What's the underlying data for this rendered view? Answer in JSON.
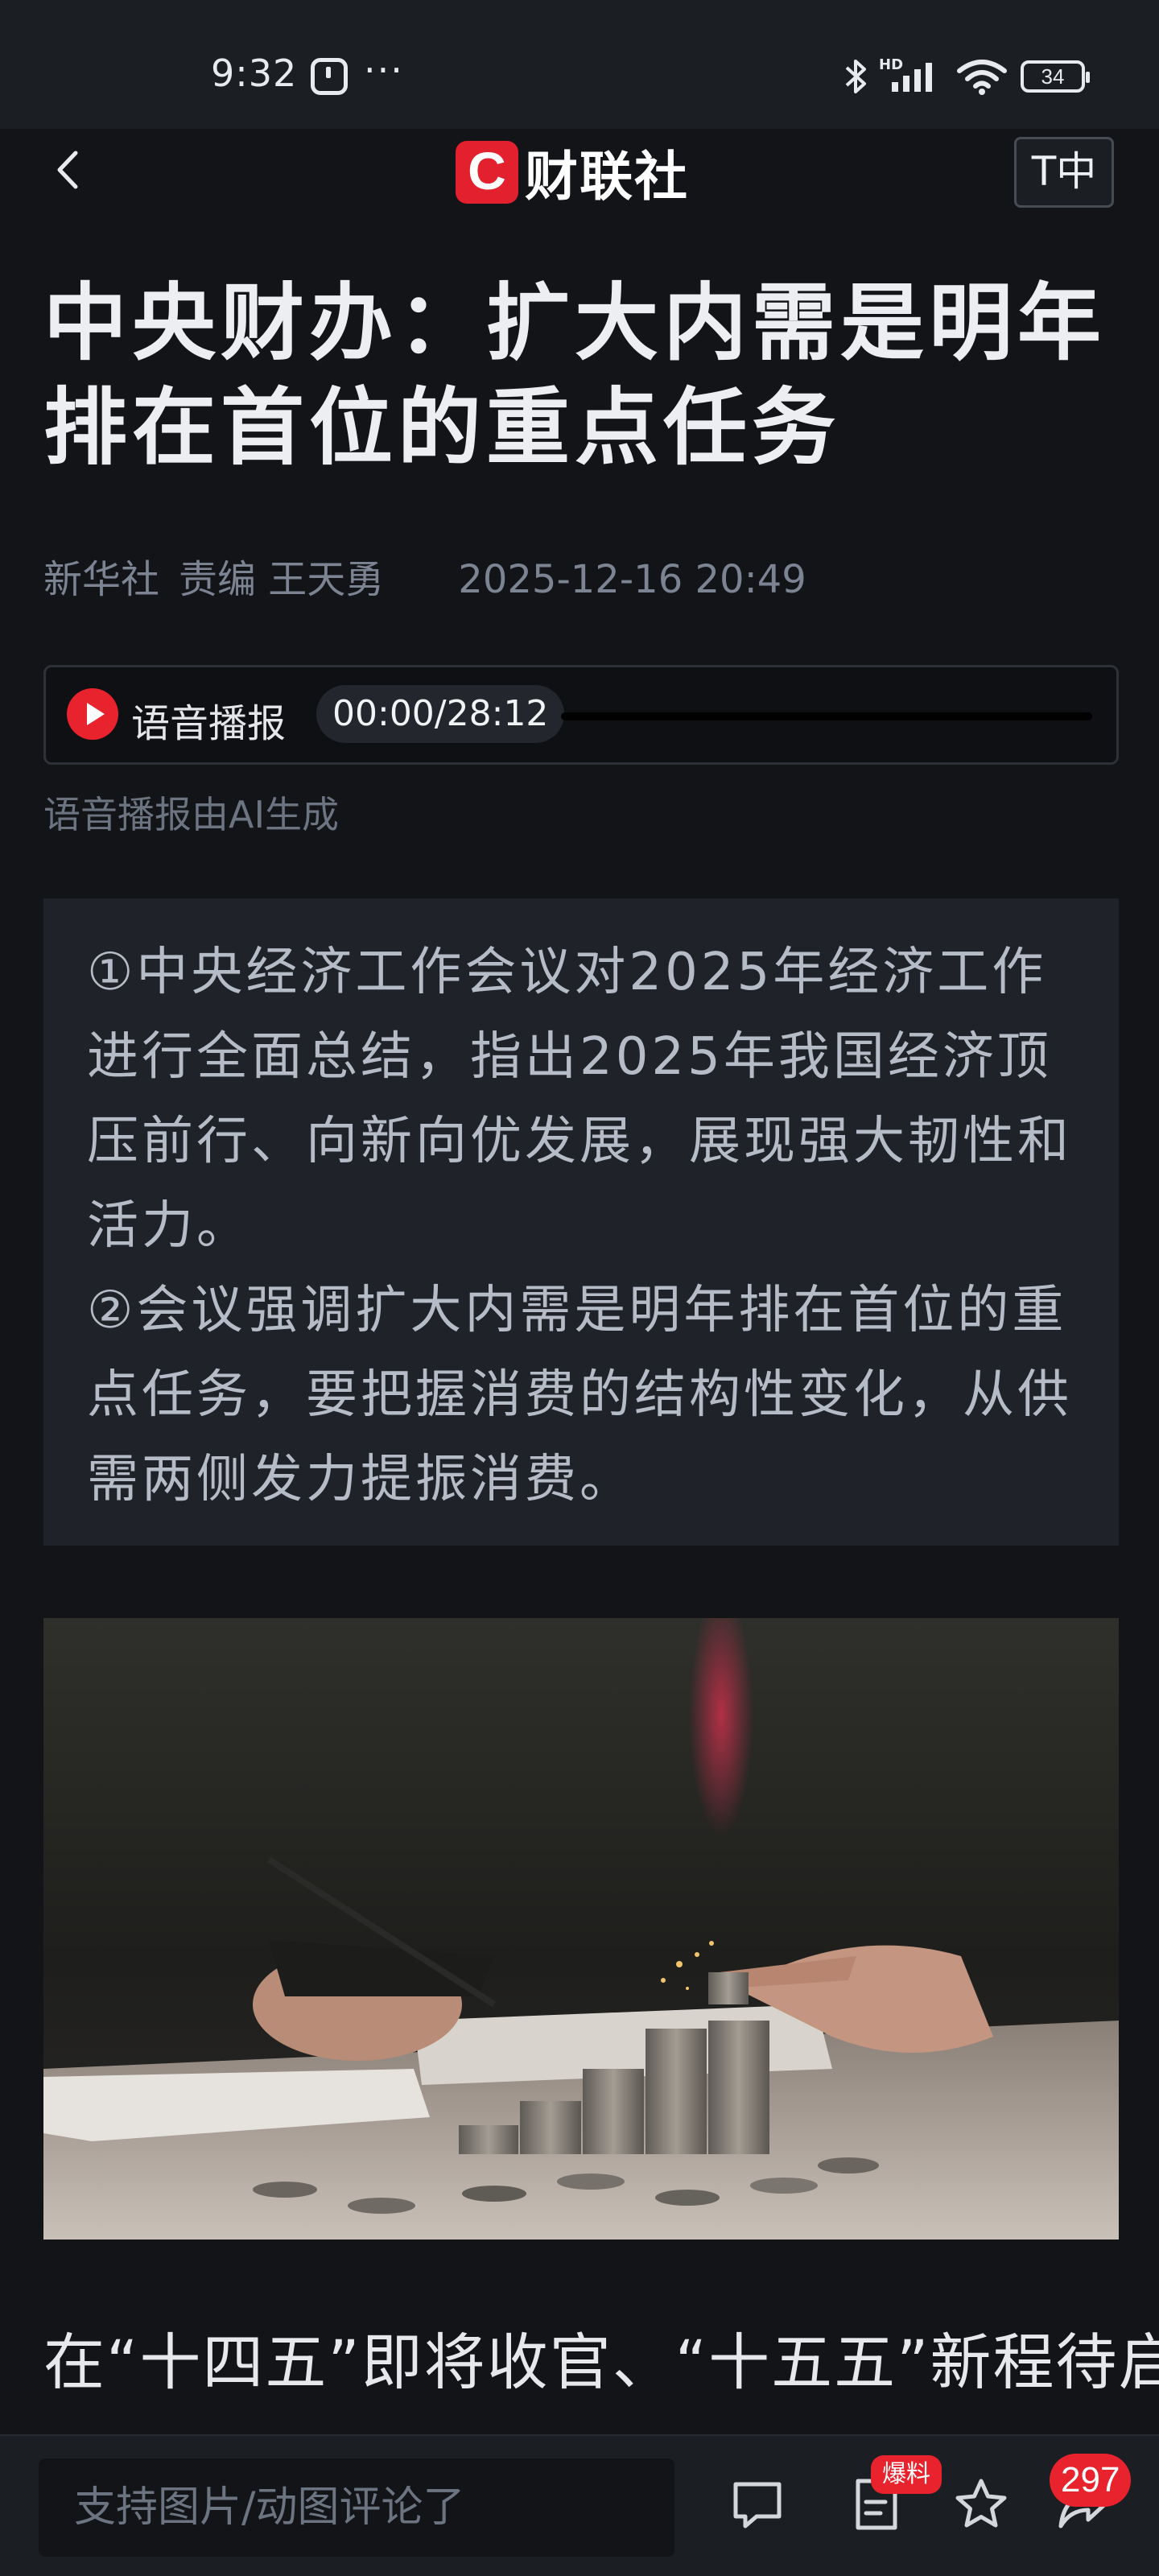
{
  "status_bar": {
    "time": "9:32",
    "more_dots": "···",
    "battery": "34",
    "network": "HD"
  },
  "nav": {
    "brand_logo_letter": "C",
    "brand_name": "财联社",
    "font_size_button": "T中",
    "icons": [
      "back-icon",
      "brand-logo-icon"
    ]
  },
  "article": {
    "title": "中央财办：扩大内需是明年排在首位的重点任务",
    "source": "新华社",
    "editor": "责编 王天勇",
    "date": "2025-12-16 20:49",
    "audio": {
      "label": "语音播报",
      "time": "00:00/28:12",
      "progress": 0,
      "note": "语音播报由AI生成"
    },
    "summary": [
      "①中央经济工作会议对2025年经济工作进行全面总结，指出2025年我国经济顶压前行、向新向优发展，展现强大韧性和活力。",
      "②会议强调扩大内需是明年排在首位的重点任务，要把握消费的结构性变化，从供需两侧发力提振消费。"
    ],
    "body_first_line": "在“十四五”即将收官、“十五五”新程待启"
  },
  "bottom_bar": {
    "comment_placeholder": "支持图片/动图评论了",
    "baoliao_badge": "爆料",
    "share_count": "297",
    "icons": [
      "comment-icon",
      "baoliao-icon",
      "favorite-icon",
      "share-icon"
    ]
  },
  "colors": {
    "background": "#121418",
    "brand_red": "#e3202d",
    "summary_background": "#1f2228"
  }
}
